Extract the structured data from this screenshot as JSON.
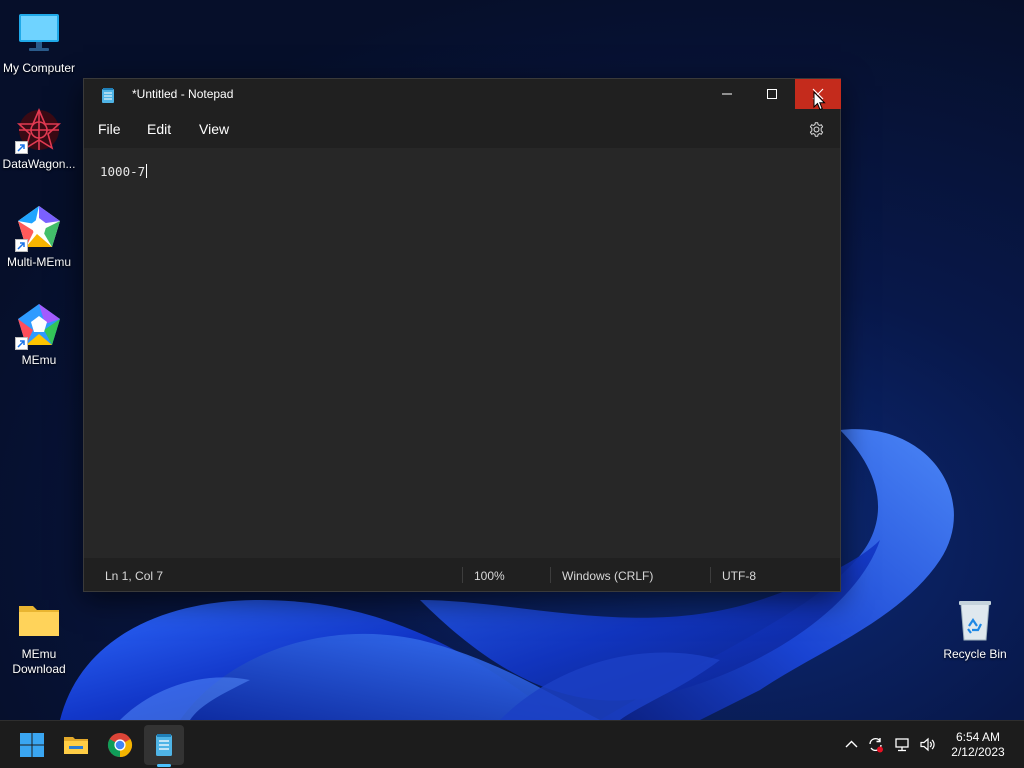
{
  "desktop": {
    "icons": [
      {
        "label": "My Computer",
        "icon": "monitor-icon"
      },
      {
        "label": "DataWagon...",
        "icon": "datawagon-app-icon"
      },
      {
        "label": "Multi-MEmu",
        "icon": "multi-memu-app-icon"
      },
      {
        "label": "MEmu",
        "icon": "memu-app-icon"
      },
      {
        "label": "MEmu Download",
        "icon": "folder-icon"
      },
      {
        "label": "Recycle Bin",
        "icon": "recycle-bin-icon"
      }
    ]
  },
  "notepad": {
    "title": "*Untitled - Notepad",
    "menu": {
      "file": "File",
      "edit": "Edit",
      "view": "View"
    },
    "content": "1000-7",
    "status": {
      "position": "Ln 1, Col 7",
      "zoom": "100%",
      "line_ending": "Windows (CRLF)",
      "encoding": "UTF-8"
    }
  },
  "taskbar": {
    "apps": [
      "windows-start-icon",
      "file-explorer-icon",
      "chrome-icon",
      "notepad-icon"
    ],
    "tray": [
      "chevron-up-icon",
      "sync-icon",
      "network-icon",
      "volume-icon"
    ],
    "time": "6:54 AM",
    "date": "2/12/2023"
  },
  "colors": {
    "accent": "#4cc2ff",
    "close_hover": "#c42b1c",
    "window_bg": "#202020",
    "editor_bg": "#272727"
  }
}
